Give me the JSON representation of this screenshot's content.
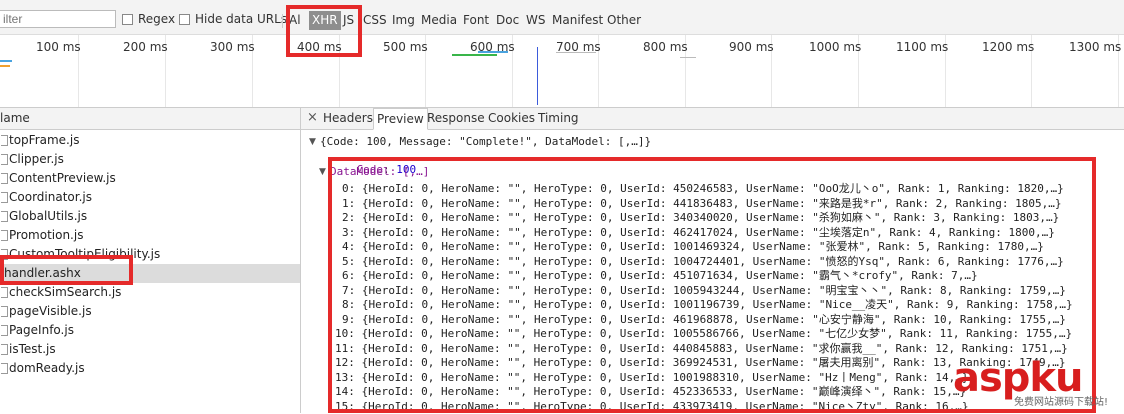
{
  "filterbar": {
    "filter_placeholder": "ilter",
    "regex_label": "Regex",
    "hide_data_urls_label": "Hide data URLs",
    "types": [
      "Al",
      "XHR",
      "JS",
      "CSS",
      "Img",
      "Media",
      "Font",
      "Doc",
      "WS",
      "Manifest",
      "Other"
    ],
    "active_type": "XHR"
  },
  "timeline": {
    "ticks": [
      "100 ms",
      "200 ms",
      "300 ms",
      "400 ms",
      "500 ms",
      "600 ms",
      "700 ms",
      "800 ms",
      "900 ms",
      "1000 ms",
      "1100 ms",
      "1200 ms",
      "1300 ms"
    ]
  },
  "left": {
    "header": "lame",
    "files": [
      "topFrame.js",
      "Clipper.js",
      "ContentPreview.js",
      "Coordinator.js",
      "GlobalUtils.js",
      "Promotion.js",
      "CustomTooltipEligibility.js",
      "handler.ashx",
      "checkSimSearch.js",
      "pageVisible.js",
      "PageInfo.js",
      "isTest.js",
      "domReady.js"
    ],
    "selected": "handler.ashx"
  },
  "right": {
    "close_glyph": "×",
    "tabs": [
      "Headers",
      "Preview",
      "Response",
      "Cookies",
      "Timing"
    ],
    "active_tab": "Preview",
    "root_line": "{Code: 100, Message: \"Complete!\", DataModel: [,…]}",
    "code_key": "Code",
    "code_value": "100",
    "datamodel_line": "DataModel: [,…]",
    "items": [
      "0: {HeroId: 0, HeroName: \"\", HeroType: 0, UserId: 450246583, UserName: \"OoO龙儿丶o\", Rank: 1, Ranking: 1820,…}",
      "1: {HeroId: 0, HeroName: \"\", HeroType: 0, UserId: 441836483, UserName: \"来路是我*r\", Rank: 2, Ranking: 1805,…}",
      "2: {HeroId: 0, HeroName: \"\", HeroType: 0, UserId: 340340020, UserName: \"杀狗如麻丶\", Rank: 3, Ranking: 1803,…}",
      "3: {HeroId: 0, HeroName: \"\", HeroType: 0, UserId: 462417024, UserName: \"尘埃落定n\", Rank: 4, Ranking: 1800,…}",
      "4: {HeroId: 0, HeroName: \"\", HeroType: 0, UserId: 1001469324, UserName: \"张爱林\", Rank: 5, Ranking: 1780,…}",
      "5: {HeroId: 0, HeroName: \"\", HeroType: 0, UserId: 1004724401, UserName: \"愤怒的Ysq\", Rank: 6, Ranking: 1776,…}",
      "6: {HeroId: 0, HeroName: \"\", HeroType: 0, UserId: 451071634, UserName: \"霸气丶*crofy\", Rank: 7,…}",
      "7: {HeroId: 0, HeroName: \"\", HeroType: 0, UserId: 1005943244, UserName: \"明宝宝丶丶\", Rank: 8, Ranking: 1759,…}",
      "8: {HeroId: 0, HeroName: \"\", HeroType: 0, UserId: 1001196739, UserName: \"Nice__凌天\", Rank: 9, Ranking: 1758,…}",
      "9: {HeroId: 0, HeroName: \"\", HeroType: 0, UserId: 461968878, UserName: \"心安宁静海\", Rank: 10, Ranking: 1755,…}",
      "10: {HeroId: 0, HeroName: \"\", HeroType: 0, UserId: 1005586766, UserName: \"七亿少女梦\", Rank: 11, Ranking: 1755,…}",
      "11: {HeroId: 0, HeroName: \"\", HeroType: 0, UserId: 440845883, UserName: \"求你赢我__\", Rank: 12, Ranking: 1751,…}",
      "12: {HeroId: 0, HeroName: \"\", HeroType: 0, UserId: 369924531, UserName: \"屠夫用离别\", Rank: 13, Ranking: 1749,…}",
      "13: {HeroId: 0, HeroName: \"\", HeroType: 0, UserId: 1001988310, UserName: \"Hz丨Meng\", Rank: 14,…}",
      "14: {HeroId: 0, HeroName: \"\", HeroType: 0, UserId: 452336533, UserName: \"巅峰演绎丶\", Rank: 15,…}",
      "15: {HeroId: 0, HeroName: \"\", HeroType: 0, UserId: 433973419, UserName: \"Nice丶Zty\", Rank: 16,…}"
    ]
  },
  "watermark": {
    "brand": "aspku",
    "subtitle": "免费网站源码下载站!"
  },
  "colors": {
    "annotation_red": "#e52a2a",
    "selected_row": "#dcdcdc",
    "active_filter": "#8e8e8e",
    "json_key": "#881391"
  }
}
